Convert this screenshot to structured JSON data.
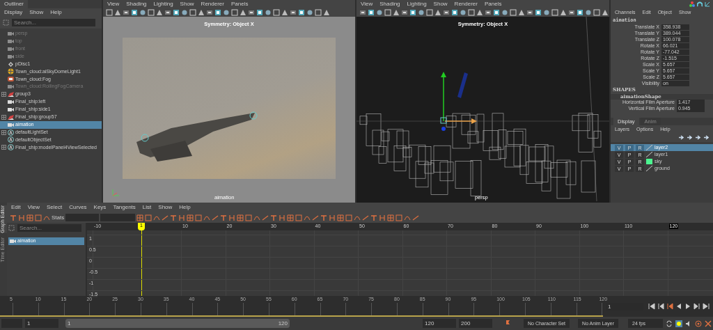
{
  "outliner": {
    "title": "Outliner",
    "menus": [
      "Display",
      "Show",
      "Help"
    ],
    "search": {
      "placeholder": "Search..."
    },
    "items": [
      {
        "label": "persp",
        "kind": "camera",
        "hidden": true,
        "expandable": false,
        "selected": false
      },
      {
        "label": "top",
        "kind": "camera",
        "hidden": true,
        "expandable": false,
        "selected": false
      },
      {
        "label": "front",
        "kind": "camera",
        "hidden": true,
        "expandable": false,
        "selected": false
      },
      {
        "label": "side",
        "kind": "camera",
        "hidden": true,
        "expandable": false,
        "selected": false
      },
      {
        "label": "pDisc1",
        "kind": "mesh",
        "hidden": false,
        "expandable": false,
        "selected": false
      },
      {
        "label": "Town_cloud:aiSkyDomeLight1",
        "kind": "light",
        "hidden": false,
        "expandable": false,
        "selected": false
      },
      {
        "label": "Town_cloud:Fog",
        "kind": "fog",
        "hidden": false,
        "expandable": false,
        "selected": false
      },
      {
        "label": "Town_cloud:RollingFogCamera",
        "kind": "camera",
        "hidden": true,
        "expandable": false,
        "selected": false
      },
      {
        "label": "group3",
        "kind": "group",
        "hidden": false,
        "expandable": true,
        "selected": false
      },
      {
        "label": "Final_ship:left",
        "kind": "camera",
        "hidden": false,
        "expandable": false,
        "selected": false
      },
      {
        "label": "Final_ship:side1",
        "kind": "camera",
        "hidden": false,
        "expandable": false,
        "selected": false
      },
      {
        "label": "Final_ship:group57",
        "kind": "group",
        "hidden": false,
        "expandable": true,
        "selected": false
      },
      {
        "label": "aimation",
        "kind": "camera",
        "hidden": false,
        "expandable": false,
        "selected": true
      },
      {
        "label": "defaultLightSet",
        "kind": "set",
        "hidden": false,
        "expandable": true,
        "selected": false
      },
      {
        "label": "defaultObjectSet",
        "kind": "set",
        "hidden": false,
        "expandable": false,
        "selected": false
      },
      {
        "label": "Final_ship:modelPanel4ViewSelected",
        "kind": "set",
        "hidden": false,
        "expandable": true,
        "selected": false
      }
    ]
  },
  "viewports": [
    {
      "kind": "render",
      "menus": [
        "View",
        "Shading",
        "Lighting",
        "Show",
        "Renderer",
        "Panels"
      ],
      "symmetry": "Symmetry: Object X",
      "camera": "aimation"
    },
    {
      "kind": "wireframe",
      "menus": [
        "View",
        "Shading",
        "Lighting",
        "Show",
        "Renderer",
        "Panels"
      ],
      "symmetry": "Symmetry: Object X",
      "camera": "persp"
    }
  ],
  "channel_box": {
    "menus": [
      "Channels",
      "Edit",
      "Object",
      "Show"
    ],
    "object": "aimation",
    "channels": [
      {
        "name": "Translate X",
        "value": "358.938"
      },
      {
        "name": "Translate Y",
        "value": "389.044"
      },
      {
        "name": "Translate Z",
        "value": "100.078"
      },
      {
        "name": "Rotate X",
        "value": "66.021"
      },
      {
        "name": "Rotate Y",
        "value": "-77.042"
      },
      {
        "name": "Rotate Z",
        "value": "-1.515"
      },
      {
        "name": "Scale X",
        "value": "5.657"
      },
      {
        "name": "Scale Y",
        "value": "5.657"
      },
      {
        "name": "Scale Z",
        "value": "5.657"
      },
      {
        "name": "Visibility",
        "value": "on"
      }
    ],
    "shapes_heading": "SHAPES",
    "shape": "aimationShape",
    "shape_channels": [
      {
        "name": "Horizontal Film Aperture",
        "value": "1.417"
      },
      {
        "name": "Vertical Film Aperture",
        "value": "0.945"
      }
    ]
  },
  "layer_editor": {
    "tabs": [
      {
        "label": "Display",
        "selected": true
      },
      {
        "label": "Anim",
        "selected": false
      }
    ],
    "menus": [
      "Layers",
      "Options",
      "Help"
    ],
    "layers": [
      {
        "name": "layer2",
        "toggles": [
          "V",
          "P",
          "R"
        ],
        "selected": true
      },
      {
        "name": "layer1",
        "toggles": [
          "V",
          "P",
          "R"
        ],
        "selected": false
      },
      {
        "name": "sky",
        "toggles": [
          "V",
          "P",
          "R"
        ],
        "selected": false,
        "color": "#4cf590"
      },
      {
        "name": "ground",
        "toggles": [
          "V",
          "P",
          "R"
        ],
        "selected": false
      }
    ]
  },
  "graph_editor": {
    "tabs": [
      {
        "label": "Graph Editor",
        "selected": true
      },
      {
        "label": "Time Editor",
        "selected": false
      }
    ],
    "menus": [
      "Edit",
      "View",
      "Select",
      "Curves",
      "Keys",
      "Tangents",
      "List",
      "Show",
      "Help"
    ],
    "stats_label": "Stats",
    "search": {
      "placeholder": "Search..."
    },
    "curves": [
      {
        "label": "aimation",
        "selected": true
      }
    ],
    "x_ticks": [
      "-10",
      "10",
      "20",
      "30",
      "40",
      "50",
      "60",
      "70",
      "80",
      "90",
      "100",
      "110",
      "120"
    ],
    "current_frame": "1",
    "y_ticks": [
      "1",
      "0.5",
      "0",
      "-0.5",
      "-1",
      "-1.5"
    ]
  },
  "timeline": {
    "ticks": [
      "5",
      "10",
      "15",
      "20",
      "25",
      "30",
      "35",
      "40",
      "45",
      "50",
      "55",
      "60",
      "65",
      "70",
      "75",
      "80",
      "85",
      "90",
      "95",
      "100",
      "105",
      "110",
      "115",
      "120"
    ],
    "frame": "1"
  },
  "range": {
    "level": 1,
    "start": "1",
    "slider_start": "1",
    "slider_end": "120",
    "end": "120",
    "max": "200",
    "character_set": "No Character Set",
    "anim_layer": "No Anim Layer",
    "fps": "24 fps"
  }
}
